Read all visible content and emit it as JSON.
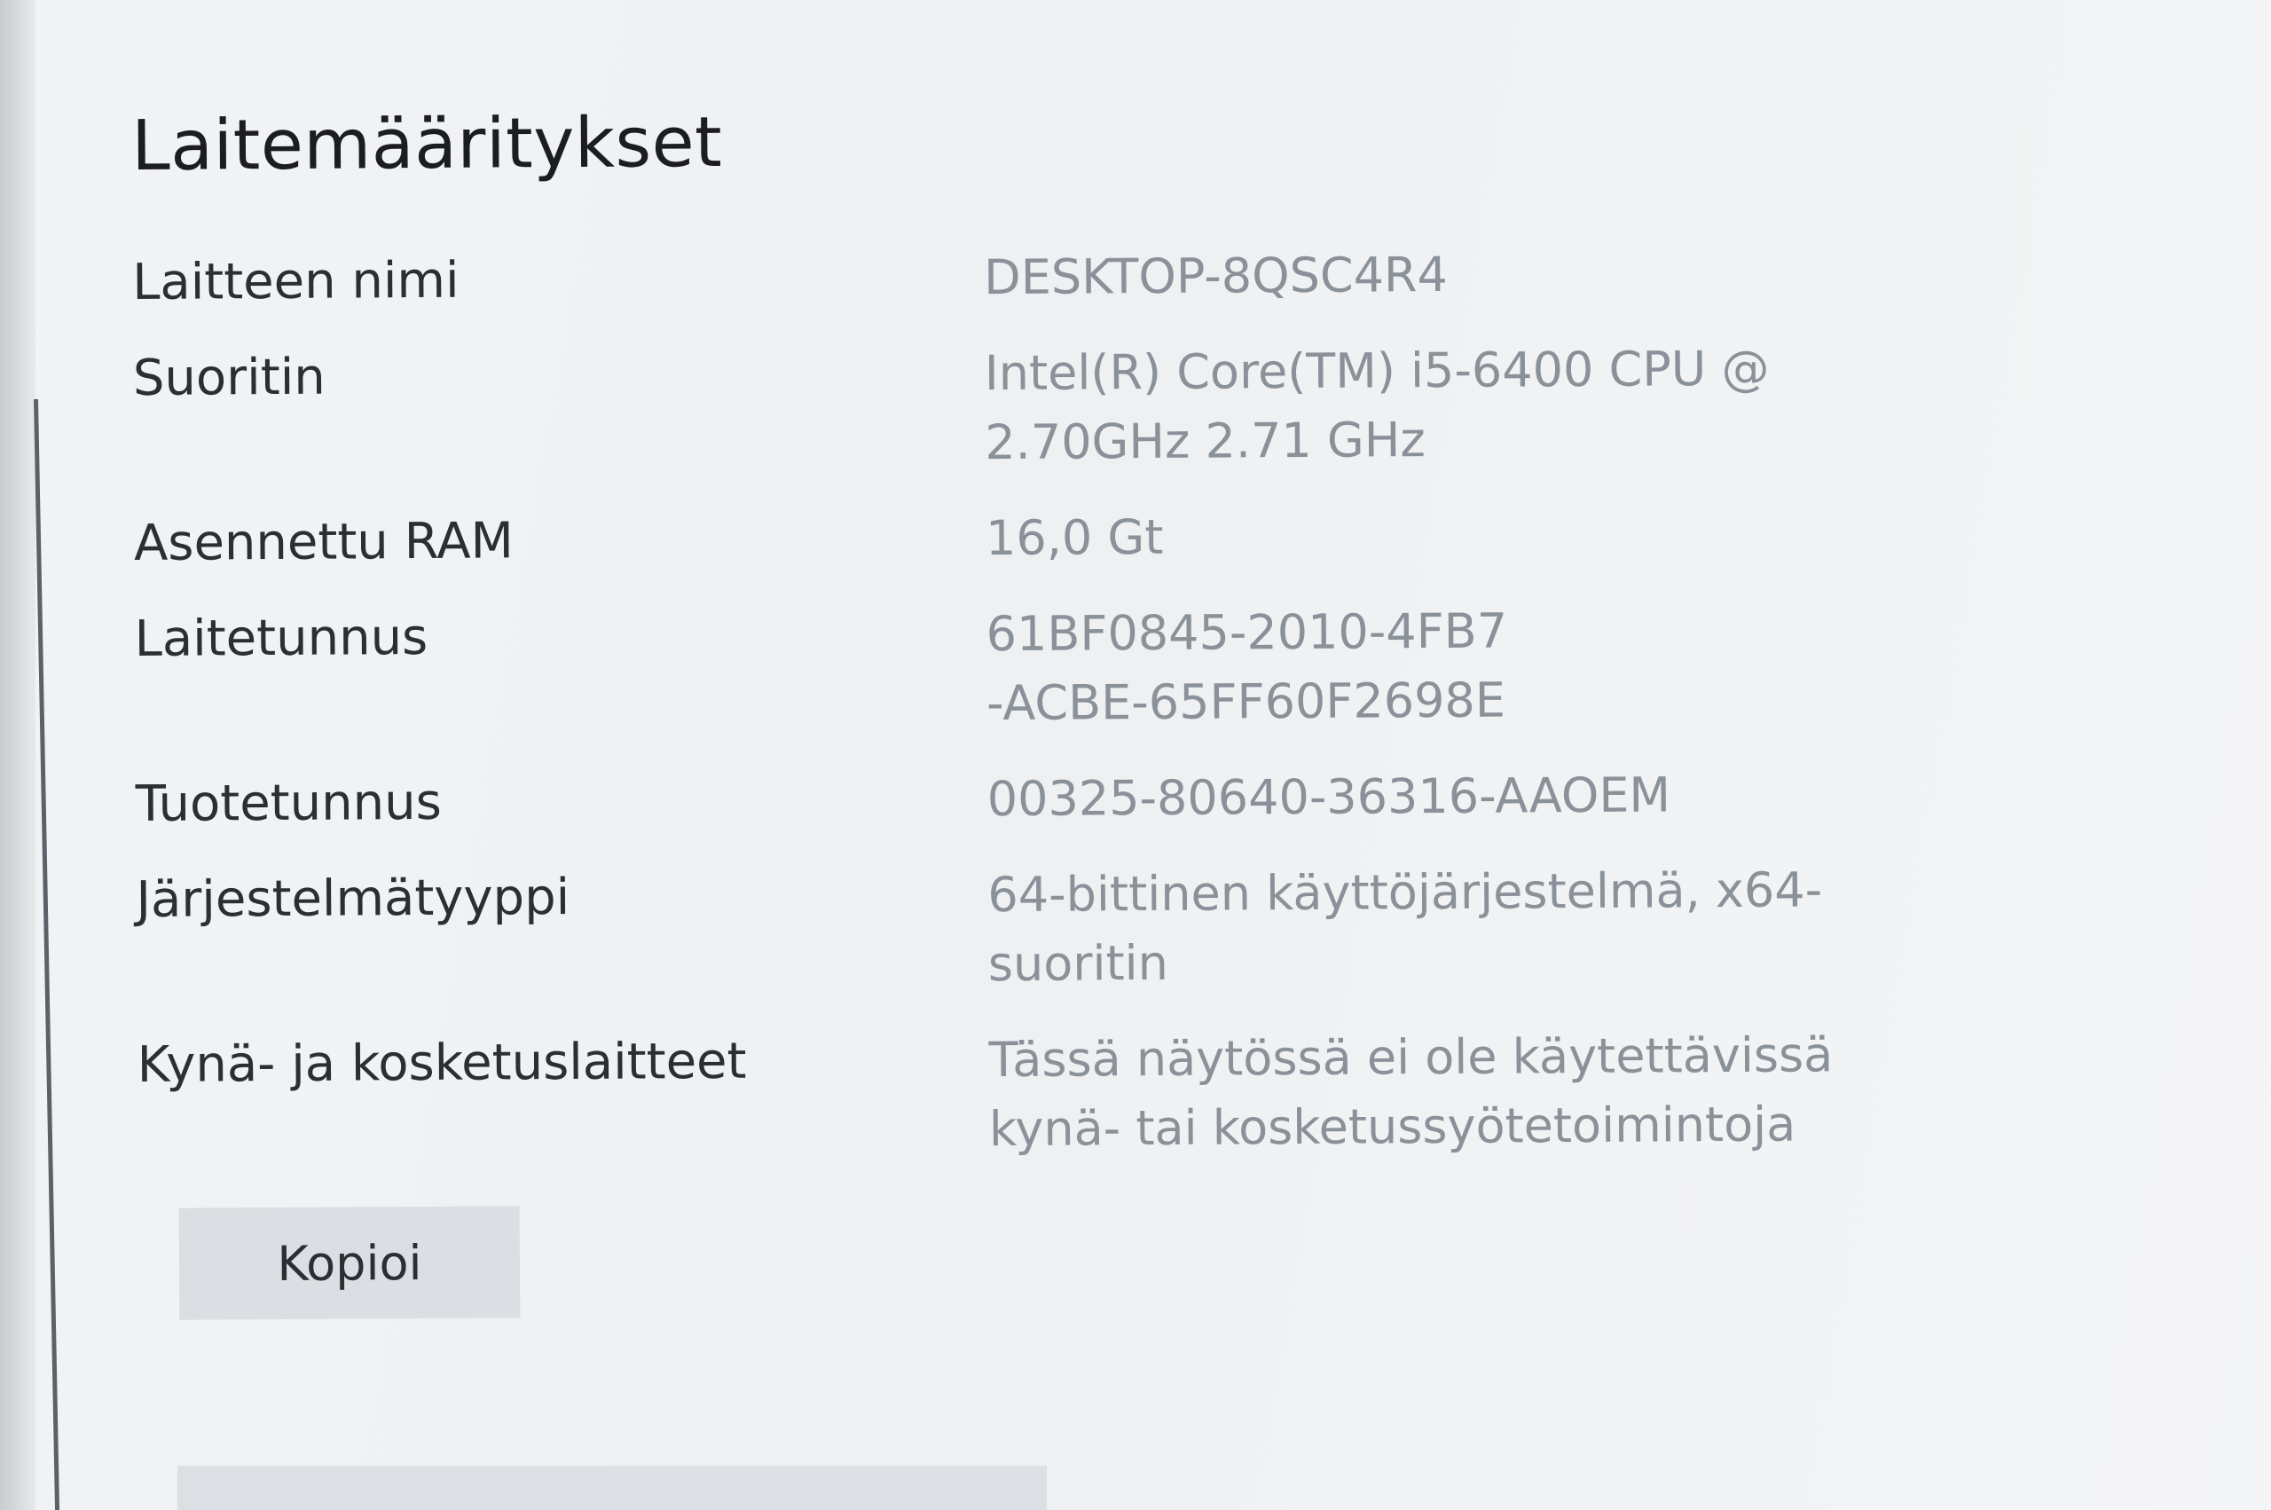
{
  "section": {
    "title": "Laitemääritykset"
  },
  "specs": [
    {
      "label": "Laitteen nimi",
      "value": "DESKTOP-8QSC4R4"
    },
    {
      "label": "Suoritin",
      "value": "Intel(R) Core(TM) i5-6400 CPU @ 2.70GHz   2.71 GHz"
    },
    {
      "label": "Asennettu RAM",
      "value": "16,0 Gt"
    },
    {
      "label": "Laitetunnus",
      "value": "61BF0845-2010-4FB7-ACBE-65FF60F2698E"
    },
    {
      "label": "Tuotetunnus",
      "value": "00325-80640-36316-AAOEM"
    },
    {
      "label": "Järjestelmätyyppi",
      "value": "64-bittinen käyttöjärjestelmä, x64-suoritin"
    },
    {
      "label": "Kynä- ja kosketuslaitteet",
      "value": "Tässä näytössä ei ole käytettävissä kynä- tai kosketussyötetoimintoja"
    }
  ],
  "actions": {
    "copy_label": "Kopioi"
  }
}
